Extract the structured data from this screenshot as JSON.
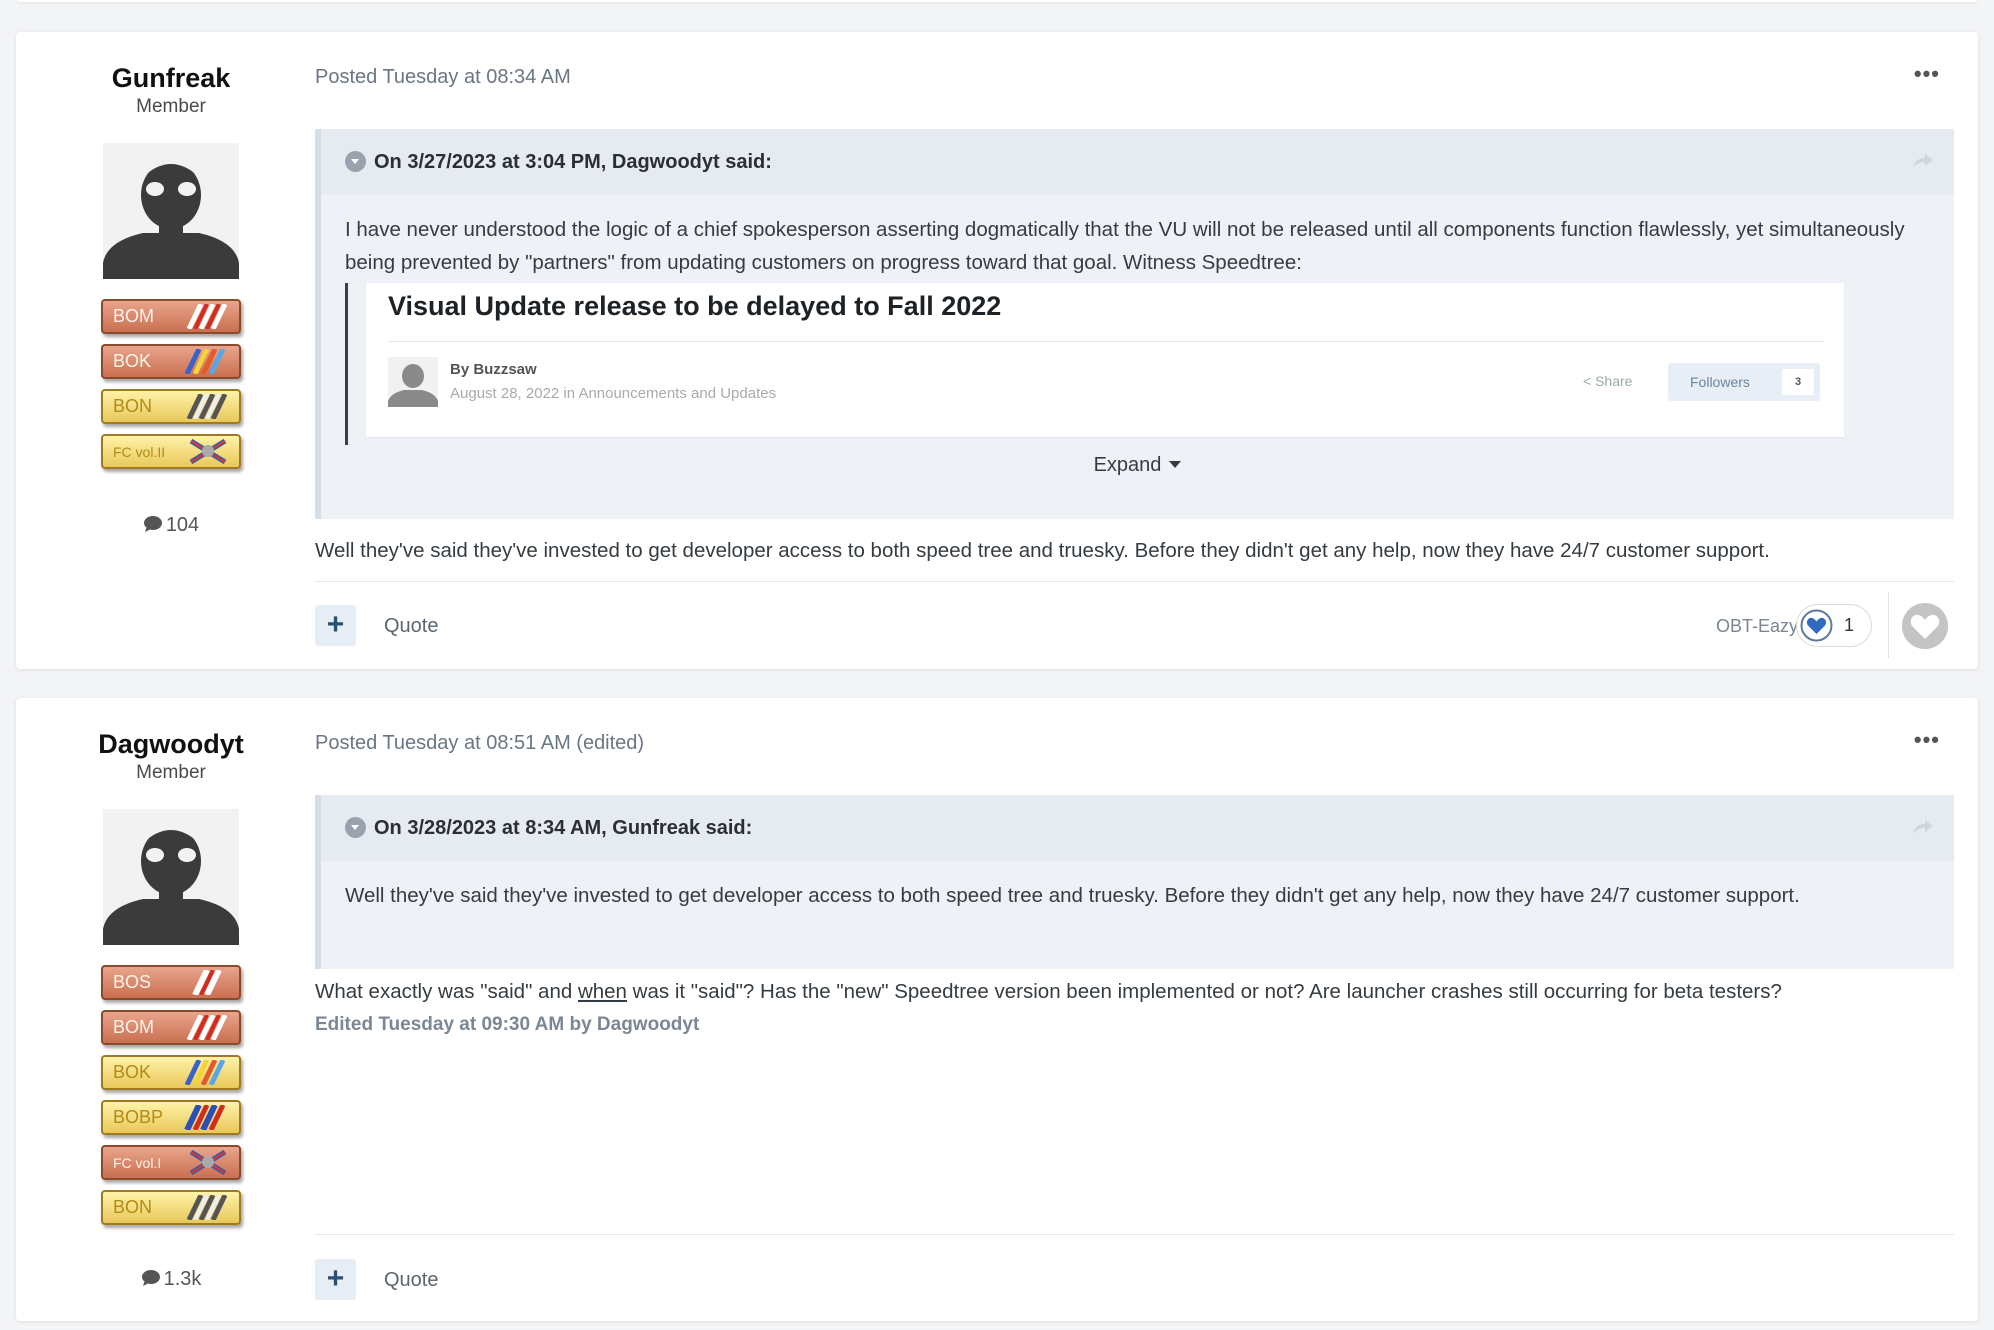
{
  "posts": [
    {
      "author": {
        "name": "Gunfreak",
        "rank": "Member",
        "post_count": "104",
        "badges": [
          "BOM",
          "BOK",
          "BON",
          "FC vol.II"
        ]
      },
      "meta": "Posted Tuesday at 08:34 AM",
      "quote": {
        "header": "On 3/27/2023 at 3:04 PM, Dagwoodyt said:",
        "text": "I have never understood the logic of a chief spokesperson asserting dogmatically that the VU will not be released until all components function flawlessly, yet simultaneously being prevented by \"partners\" from updating customers on progress toward that goal. Witness Speedtree:",
        "embed": {
          "title": "Visual Update release to be delayed to Fall 2022",
          "by": "By Buzzsaw",
          "date": "August 28, 2022 in Announcements and Updates",
          "share": "Share",
          "followers": "Followers",
          "followers_count": "3"
        },
        "expand": "Expand"
      },
      "text": "Well they've said they've invested to get developer access to both speed tree and truesky. Before they didn't get any help, now they have 24/7 customer support.",
      "quote_label": "Quote",
      "reaction": {
        "user": "OBT-Eazy",
        "count": "1"
      }
    },
    {
      "author": {
        "name": "Dagwoodyt",
        "rank": "Member",
        "post_count": "1.3k",
        "badges": [
          "BOS",
          "BOM",
          "BOK",
          "BOBP",
          "FC vol.I",
          "BON"
        ]
      },
      "meta": "Posted Tuesday at 08:51 AM (edited)",
      "quote": {
        "header": "On 3/28/2023 at 8:34 AM, Gunfreak said:",
        "text": "Well they've said they've invested to get developer access to both speed tree and truesky. Before they didn't get any help, now they have 24/7 customer support."
      },
      "text_before": "What exactly was \"said\" and ",
      "text_underlined": "when",
      "text_after": " was it \"said\"? Has the \"new\" Speedtree version been implemented or not? Are launcher crashes still occurring for beta testers?",
      "edited": "Edited Tuesday at 09:30 AM by Dagwoodyt",
      "quote_label": "Quote"
    }
  ],
  "icons": {
    "more": "ellipsis-icon",
    "share": "share-arrow-icon",
    "comment": "comment-icon",
    "heart": "heart-icon"
  },
  "colors": {
    "quote_bg": "#eef2f7",
    "plus_btn": "#e6edf5",
    "link": "#2b4f73"
  }
}
